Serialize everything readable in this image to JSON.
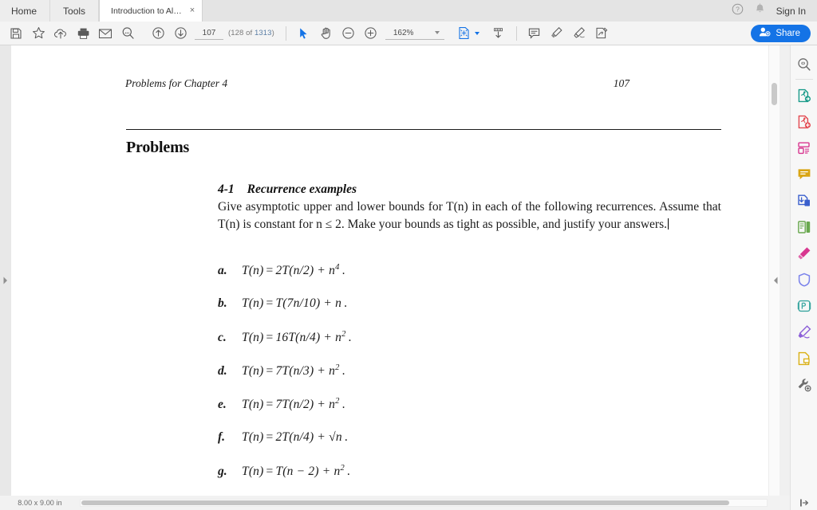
{
  "tabs": {
    "home_label": "Home",
    "tools_label": "Tools",
    "document_label": "Introduction to Al…",
    "close_glyph": "×"
  },
  "account": {
    "sign_in_label": "Sign In",
    "help_icon": "help-circle-icon",
    "bell_icon": "bell-icon"
  },
  "toolbar": {
    "save_icon": "save-floppy-icon",
    "star_icon": "star-icon",
    "upload_icon": "upload-cloud-icon",
    "print_icon": "print-icon",
    "email_icon": "email-envelope-icon",
    "search_icon": "search-icon",
    "prev_page_icon": "arrow-up-circle-icon",
    "next_page_icon": "arrow-down-circle-icon",
    "page_number": "107",
    "page_number_placeholder": "107",
    "page_count_prefix": "(128 of ",
    "page_count_total": "1313",
    "page_count_suffix": ")",
    "select_icon": "cursor-select-icon",
    "hand_icon": "hand-pan-icon",
    "zoom_out_icon": "zoom-out-icon",
    "zoom_in_icon": "zoom-in-icon",
    "zoom_level": "162%",
    "page_fit_icon": "page-fit-icon",
    "scroll_mode_icon": "scroll-mode-icon",
    "comment_icon": "comment-icon",
    "highlight_icon": "highlight-marker-icon",
    "draw_icon": "draw-pen-icon",
    "sign_icon": "sign-stamp-icon",
    "share_label": "Share",
    "share_icon": "share-person-icon",
    "accent_blue": "#1473e6"
  },
  "document": {
    "running_head": "Problems for Chapter 4",
    "folio": "107",
    "section_heading": "Problems",
    "problem_number": "4-1",
    "problem_title": "Recurrence examples",
    "problem_body": "Give asymptotic upper and lower bounds for T(n) in each of the following recurrences. Assume that T(n) is constant for n ≤ 2. Make your bounds as tight as possible, and justify your answers.",
    "equations": [
      {
        "label": "a.",
        "lhs": "T(n)",
        "rel": "=",
        "rhs": "2T(n/2) + n",
        "exp": "4",
        "tail": "."
      },
      {
        "label": "b.",
        "lhs": "T(n)",
        "rel": "=",
        "rhs": "T(7n/10) + n",
        "exp": "",
        "tail": "."
      },
      {
        "label": "c.",
        "lhs": "T(n)",
        "rel": "=",
        "rhs": "16T(n/4) + n",
        "exp": "2",
        "tail": "."
      },
      {
        "label": "d.",
        "lhs": "T(n)",
        "rel": "=",
        "rhs": "7T(n/3) + n",
        "exp": "2",
        "tail": "."
      },
      {
        "label": "e.",
        "lhs": "T(n)",
        "rel": "=",
        "rhs": "7T(n/2) + n",
        "exp": "2",
        "tail": "."
      },
      {
        "label": "f.",
        "lhs": "T(n)",
        "rel": "=",
        "rhs": "2T(n/4) + √n",
        "exp": "",
        "tail": "."
      },
      {
        "label": "g.",
        "lhs": "T(n)",
        "rel": "=",
        "rhs": "T(n − 2) + n",
        "exp": "2",
        "tail": "."
      }
    ]
  },
  "rail": {
    "items": [
      {
        "name": "search-document-icon",
        "color": "#6e6e6e"
      },
      {
        "name": "export-pdf-icon",
        "color": "#1a9b8a"
      },
      {
        "name": "create-pdf-icon",
        "color": "#e34850"
      },
      {
        "name": "edit-pdf-icon",
        "color": "#d83790"
      },
      {
        "name": "comment-tool-icon",
        "color": "#d9a514"
      },
      {
        "name": "combine-files-icon",
        "color": "#3a5fcd"
      },
      {
        "name": "organize-pages-icon",
        "color": "#6aa84f"
      },
      {
        "name": "highlight-tool-icon",
        "color": "#d83790"
      },
      {
        "name": "protect-icon",
        "color": "#7b83eb"
      },
      {
        "name": "stamp-icon",
        "color": "#3aa6a0"
      },
      {
        "name": "fill-and-sign-icon",
        "color": "#8c5fd8"
      },
      {
        "name": "annotate-document-icon",
        "color": "#d9b014"
      },
      {
        "name": "more-tools-wrench-icon",
        "color": "#6e6e6e"
      }
    ]
  },
  "status": {
    "page_size": "8.00 x 9.00 in",
    "expand_panel_icon": "expand-panel-icon",
    "collapse_panel_icon": "collapse-panel-icon",
    "left_pane_expand_icon": "left-pane-expand-icon"
  }
}
